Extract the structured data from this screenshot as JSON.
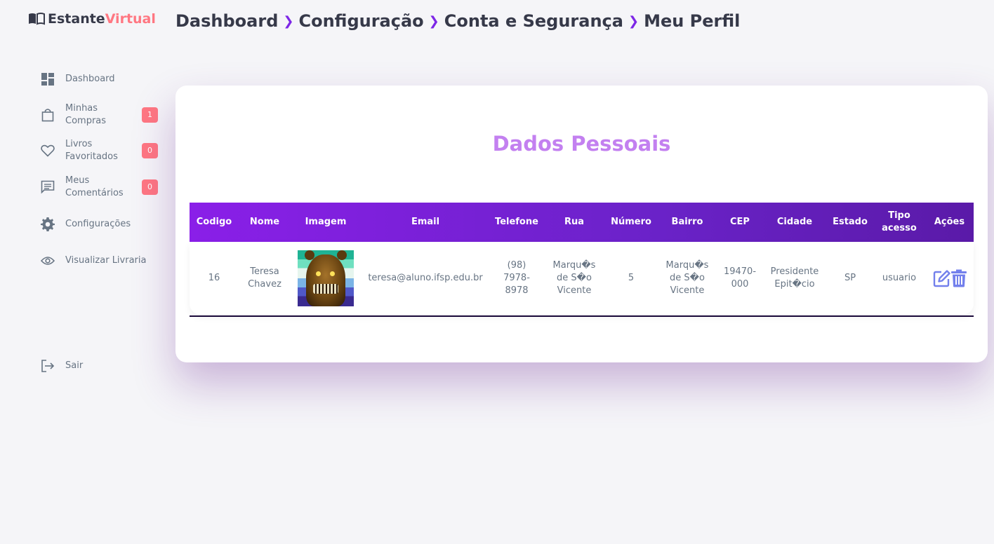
{
  "app": {
    "logo_main": "Estante",
    "logo_accent": "Virtual"
  },
  "breadcrumb": [
    "Dashboard",
    "Configuração",
    "Conta e Segurança",
    "Meu Perfil"
  ],
  "sidebar": {
    "items": [
      {
        "icon": "dashboard-icon",
        "label": "Dashboard",
        "badge": ""
      },
      {
        "icon": "shopping-bag-icon",
        "label": "Minhas Compras",
        "badge": "1"
      },
      {
        "icon": "heart-icon",
        "label": "Livros Favoritados",
        "badge": "0"
      },
      {
        "icon": "comment-icon",
        "label": "Meus Comentários",
        "badge": "0"
      },
      {
        "icon": "gear-icon",
        "label": "Configurações",
        "badge": ""
      },
      {
        "icon": "eye-icon",
        "label": "Visualizar Livraria",
        "badge": ""
      }
    ],
    "logout_label": "Sair"
  },
  "card": {
    "title": "Dados Pessoais"
  },
  "table": {
    "headers": [
      "Codigo",
      "Nome",
      "Imagem",
      "Email",
      "Telefone",
      "Rua",
      "Número",
      "Bairro",
      "CEP",
      "Cidade",
      "Estado",
      "Tipo acesso",
      "Ações"
    ],
    "rows": [
      {
        "codigo": "16",
        "nome": "Teresa Chavez",
        "imagem": "avatar-image",
        "email": "teresa@aluno.ifsp.edu.br",
        "telefone": "(98) 7978-8978",
        "rua": "Marqu�s de S�o Vicente",
        "numero": "5",
        "bairro": "Marqu�s de S�o Vicente",
        "cep": "19470-000",
        "cidade": "Presidente Epit�cio",
        "estado": "SP",
        "tipo_acesso": "usuario"
      }
    ]
  },
  "colors": {
    "accent": "#7d27e6",
    "badge": "#ff7782",
    "title": "#c380f0",
    "action_icon": "#7380ec"
  }
}
